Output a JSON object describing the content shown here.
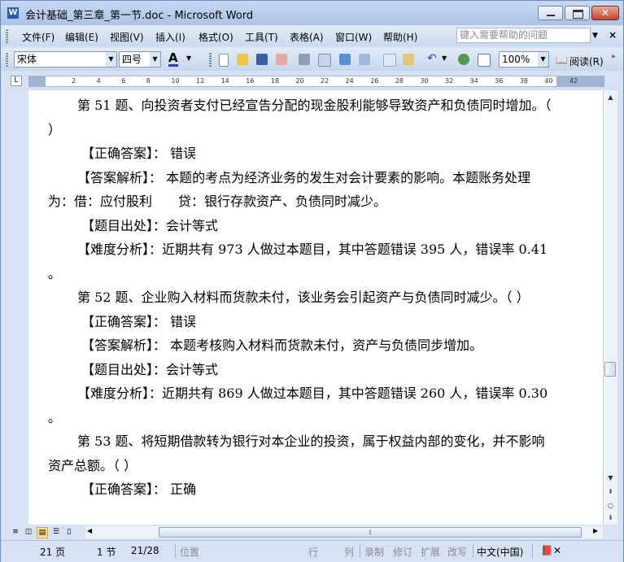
{
  "window": {
    "title": "会计基础_第三章_第一节.doc - Microsoft Word",
    "app_icon": "W"
  },
  "menu": {
    "items": [
      "文件(F)",
      "编辑(E)",
      "视图(V)",
      "插入(I)",
      "格式(O)",
      "工具(T)",
      "表格(A)",
      "窗口(W)",
      "帮助(H)"
    ],
    "help_placeholder": "键入需要帮助的问题"
  },
  "toolbar": {
    "font": "宋体",
    "size": "四号",
    "zoom": "100%",
    "read_label": "阅读(R)"
  },
  "ruler": {
    "marks": [
      "2",
      "4",
      "6",
      "8",
      "10",
      "12",
      "14",
      "16",
      "18",
      "20",
      "22",
      "24",
      "26",
      "28",
      "30",
      "32",
      "34",
      "36",
      "38",
      "40",
      "42"
    ]
  },
  "document": {
    "paragraphs": [
      {
        "cls": "ind",
        "text": "第 51 题、向投资者支付已经宣告分配的现金股利能够导致资产和负债同时增加。（ ）"
      },
      {
        "cls": "ind2",
        "text": "【正确答案】： 错误"
      },
      {
        "cls": "ind",
        "text": "【答案解析】： 本题的考点为经济业务的发生对会计要素的影响。本题账务处理为：借：应付股利　　贷：银行存款资产、负债同时减少。"
      },
      {
        "cls": "ind2",
        "text": "【题目出处】：会计等式"
      },
      {
        "cls": "ind",
        "text": "【难度分析】：近期共有 973 人做过本题目，其中答题错误 395 人，错误率 0.41 。"
      },
      {
        "cls": "ind",
        "text": "第 52 题、企业购入材料而货款未付，该业务会引起资产与负债同时减少。（ ）"
      },
      {
        "cls": "ind2",
        "text": "【正确答案】： 错误"
      },
      {
        "cls": "ind2",
        "text": "【答案解析】： 本题考核购入材料而货款未付，资产与负债同步增加。"
      },
      {
        "cls": "ind2",
        "text": "【题目出处】：会计等式"
      },
      {
        "cls": "ind",
        "text": "【难度分析】：近期共有 869 人做过本题目，其中答题错误 260 人，错误率 0.30 。"
      },
      {
        "cls": "ind",
        "text": "第 53 题、将短期借款转为银行对本企业的投资，属于权益内部的变化，并不影响资产总额。（ ）"
      },
      {
        "cls": "ind2",
        "text": "【正确答案】： 正确"
      }
    ]
  },
  "status": {
    "page": "21 页",
    "section": "1 节",
    "pages": "21/28",
    "position": "位置",
    "line": "行",
    "col": "列",
    "rec": "录制",
    "trk": "修订",
    "ext": "扩展",
    "ovr": "改写",
    "lang": "中文(中国)"
  }
}
